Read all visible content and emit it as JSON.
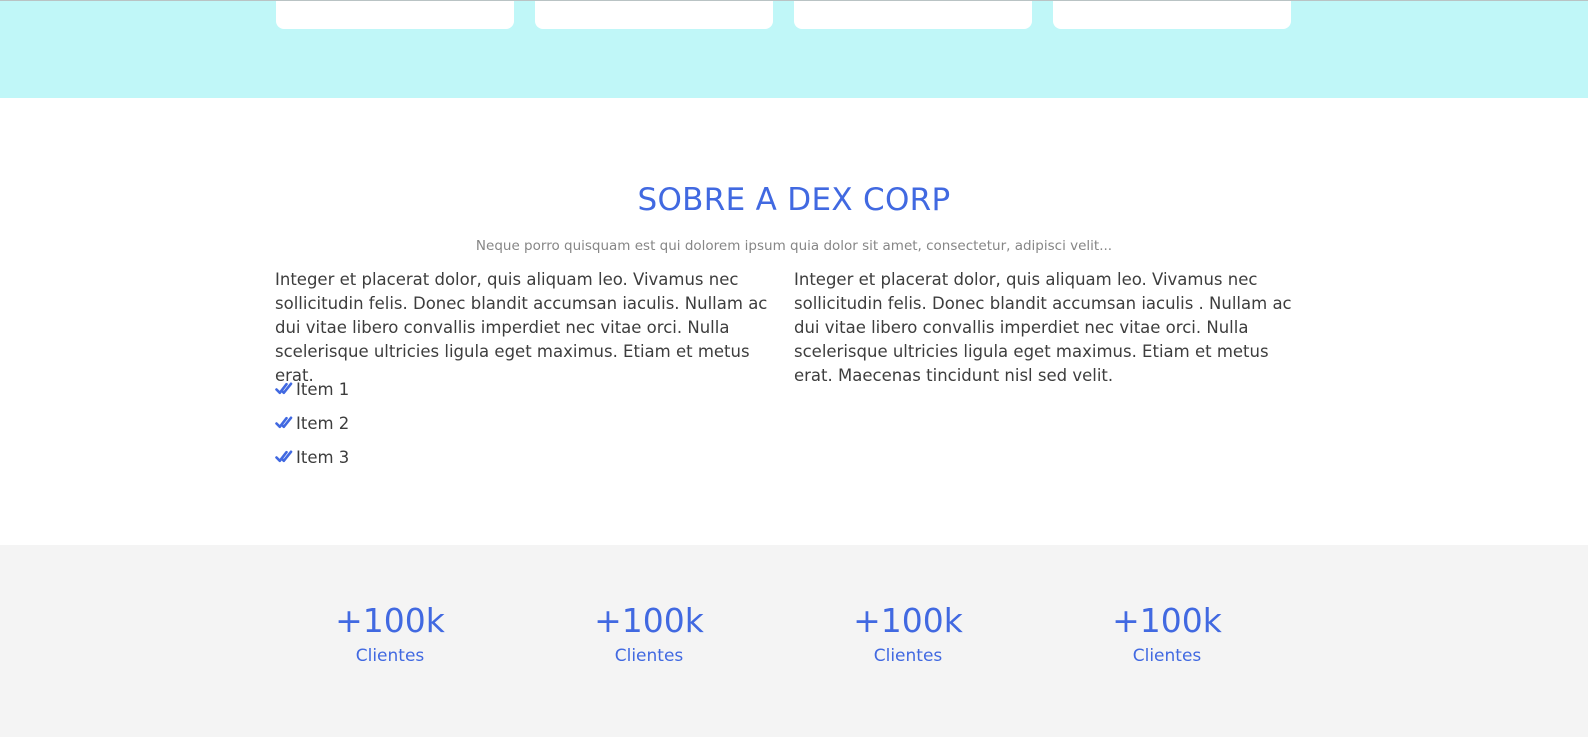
{
  "top_cards": [
    {
      "id": 1
    },
    {
      "id": 2
    },
    {
      "id": 3
    },
    {
      "id": 4
    }
  ],
  "about": {
    "title": "SOBRE A DEX CORP",
    "subtitle": "Neque porro quisquam est qui dolorem ipsum quia dolor sit amet, consectetur, adipisci velit...",
    "left_paragraph": "Integer et placerat dolor, quis aliquam leo. Vivamus nec sollicitudin felis. Donec blandit accumsan iaculis. Nullam ac dui vitae libero convallis imperdiet nec vitae orci. Nulla scelerisque ultricies ligula eget maximus. Etiam et metus erat.",
    "right_paragraph": "Integer et placerat dolor, quis aliquam leo. Vivamus nec sollicitudin felis. Donec blandit accumsan iaculis . Nullam ac dui vitae libero convallis imperdiet nec vitae orci. Nulla scelerisque ultricies ligula eget maximus. Etiam et metus erat. Maecenas tincidunt nisl sed velit.",
    "items": [
      {
        "label": "Item 1",
        "icon": "double-check-icon"
      },
      {
        "label": "Item 2",
        "icon": "double-check-icon"
      },
      {
        "label": "Item 3",
        "icon": "double-check-icon"
      }
    ]
  },
  "stats": [
    {
      "value": "+100k",
      "label": "Clientes"
    },
    {
      "value": "+100k",
      "label": "Clientes"
    },
    {
      "value": "+100k",
      "label": "Clientes"
    },
    {
      "value": "+100k",
      "label": "Clientes"
    }
  ],
  "colors": {
    "accent": "#4169e1",
    "top_band": "#c0f7f8",
    "stats_band": "#f4f4f4",
    "body_text": "#3d3d3d",
    "muted_text": "#868686"
  }
}
